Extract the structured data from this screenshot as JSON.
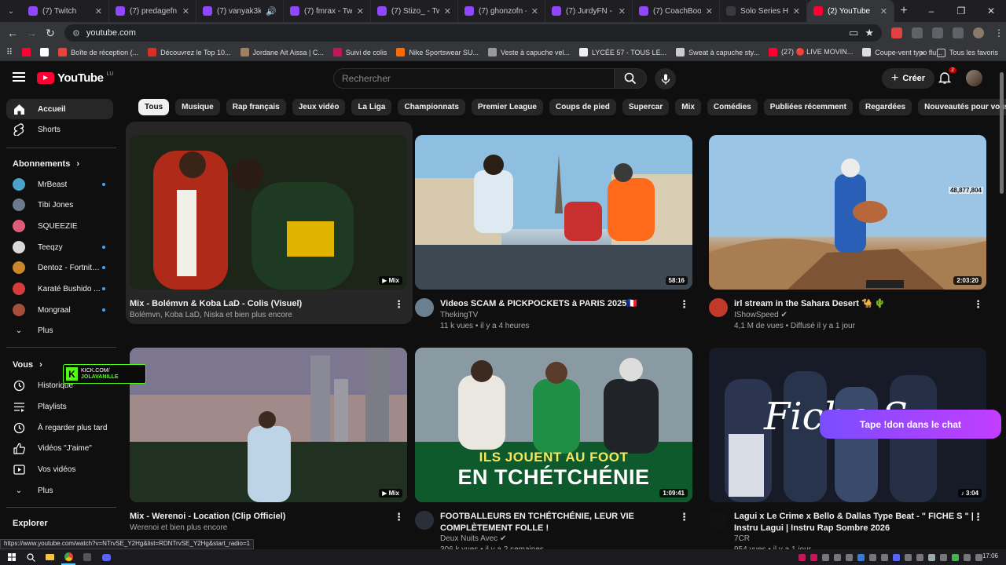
{
  "browser": {
    "tabs": [
      {
        "label": "(7) Twitch",
        "icon": "twitch-icon"
      },
      {
        "label": "(7) predagefn - Tw",
        "icon": "twitch-icon"
      },
      {
        "label": "(7) vanyak3ki",
        "icon": "twitch-icon"
      },
      {
        "label": "(7) fmrax - Twitch",
        "icon": "twitch-icon"
      },
      {
        "label": "(7) Stizo_ - Twitch",
        "icon": "twitch-icon"
      },
      {
        "label": "(7) ghonzofn - Tw",
        "icon": "twitch-icon"
      },
      {
        "label": "(7) JurdyFN - Twit",
        "icon": "twitch-icon"
      },
      {
        "label": "(7) CoachBoop - T",
        "icon": "twitch-icon"
      },
      {
        "label": "Solo Series Heats",
        "icon": "generic-icon"
      },
      {
        "label": "(2) YouTube",
        "icon": "youtube-icon",
        "active": true
      }
    ],
    "url": "youtube.com",
    "bookmarks": [
      "Boîte de réception (...",
      "Découvrez le Top 10...",
      "Jordane Ait Aissa | C...",
      "Suivi de colis",
      "Nike Sportswear SU...",
      "Veste à capuche vel...",
      "LYCÉE 57 - TOUS LE...",
      "Sweat à capuche sty...",
      "(27) 🔴 LIVE MOVIN...",
      "Coupe-vent typo flu..."
    ],
    "bookmarks_all": "Tous les favoris",
    "status_url": "https://www.youtube.com/watch?v=NTrvSE_Y2Hg&list=RDNTrvSE_Y2Hg&start_radio=1"
  },
  "youtube": {
    "logo": "YouTube",
    "logo_country": "LU",
    "search_placeholder": "Rechercher",
    "create_label": "Créer",
    "notif_count": "2"
  },
  "sidebar": {
    "main": [
      {
        "label": "Accueil",
        "icon": "home-icon",
        "active": true
      },
      {
        "label": "Shorts",
        "icon": "shorts-icon"
      }
    ],
    "subs_title": "Abonnements",
    "subs": [
      {
        "label": "MrBeast",
        "color": "#4aa3c9"
      },
      {
        "label": "Tibi Jones",
        "color": "#6d7b8c"
      },
      {
        "label": "SQUEEZIE",
        "color": "#e05a7a"
      },
      {
        "label": "Teeqzy",
        "color": "#d9d9d9"
      },
      {
        "label": "Dentoz - Fortnite ...",
        "color": "#c9872a"
      },
      {
        "label": "Karaté Bushido ...",
        "color": "#d83b3b"
      },
      {
        "label": "Mongraal",
        "color": "#a34f3a"
      }
    ],
    "subs_more": "Plus",
    "you_title": "Vous",
    "you": [
      {
        "label": "Historique",
        "icon": "history-icon"
      },
      {
        "label": "Playlists",
        "icon": "playlists-icon"
      },
      {
        "label": "À regarder plus tard",
        "icon": "watch-later-icon"
      },
      {
        "label": "Vidéos \"J'aime\"",
        "icon": "like-icon"
      },
      {
        "label": "Vos vidéos",
        "icon": "your-videos-icon"
      }
    ],
    "you_more": "Plus",
    "explore_title": "Explorer"
  },
  "chips": [
    "Tous",
    "Musique",
    "Rap français",
    "Jeux vidéo",
    "La Liga",
    "Championnats",
    "Premier League",
    "Coups de pied",
    "Supercar",
    "Mix",
    "Comédies",
    "Publiées récemment",
    "Regardées",
    "Nouveautés pour vous"
  ],
  "videos": [
    {
      "title": "Mix - Bolémvn & Koba LaD - Colis (Visuel)",
      "line1": "Bolémvn, Koba LaD, Niska et bien plus encore",
      "line2": "",
      "badge": "Mix",
      "mix": true
    },
    {
      "title": "Videos SCAM & PICKPOCKETS à PARIS 2025🇫🇷",
      "line1": "ThekingTV",
      "line2": "11 k vues • il y a 4 heures",
      "badge": "58:16",
      "avatar": "#6a7f8f"
    },
    {
      "title": "irl stream in the Sahara  Desert 🐪 🌵",
      "line1": "IShowSpeed ✔",
      "line2": "4,1 M de vues • Diffusé il y a 1 jour",
      "badge": "2:03:20",
      "avatar": "#c0392b",
      "overlay": "48,877,804"
    },
    {
      "title": "Mix - Werenoi - Location (Clip Officiel)",
      "line1": "Werenoi et bien plus encore",
      "line2": "",
      "badge": "Mix",
      "mix": true
    },
    {
      "title": "FOOTBALLEURS EN TCHÉTCHÉNIE, LEUR VIE COMPLÈTEMENT FOLLE !",
      "line1": "Deux Nuits Avec ✔",
      "line2": "306 k vues • il y a 2 semaines",
      "badge": "1:09:41",
      "avatar": "#2a2f3a",
      "thumb_line1": "ILS JOUENT AU FOOT",
      "thumb_line2": "EN TCHÉTCHÉNIE"
    },
    {
      "title": "Lagui x Le Crime x Bello & Dallas Type Beat - \" FICHE S \" | Instru Lagui | Instru Rap Sombre 2026",
      "line1": "7CR",
      "line2": "954 vues • il y a 1 jour",
      "badge": "♪ 3:04",
      "avatar": "#111111",
      "thumb_text": "Fiche S"
    }
  ],
  "overlays": {
    "kick_top": "KICK.COM/",
    "kick_name": "JOLAVANILLE",
    "chat_pill": "Tape !don dans le chat"
  },
  "taskbar": {
    "time": "17:06"
  },
  "colors": {
    "accent": "#ff0033",
    "bg": "#0f0f0f",
    "kick": "#53fc18",
    "pill_start": "#7b4dff",
    "pill_end": "#c23dff"
  }
}
